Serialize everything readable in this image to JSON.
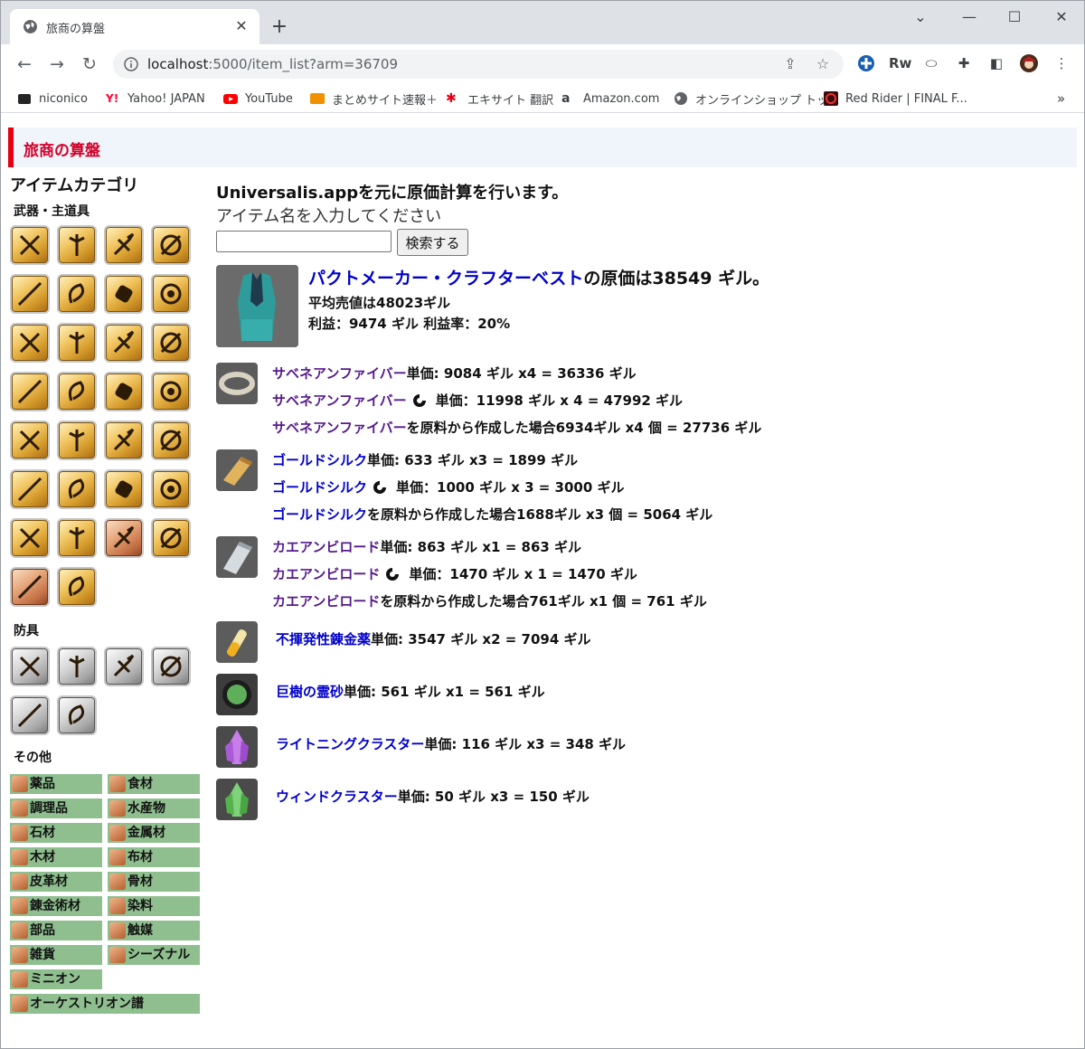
{
  "browser": {
    "tab_title": "旅商の算盤",
    "url_host": "localhost",
    "url_rest": ":5000/item_list?arm=36709",
    "bookmarks": [
      "niconico",
      "Yahoo! JAPAN",
      "YouTube",
      "まとめサイト速報＋",
      "エキサイト 翻訳",
      "Amazon.com",
      "オンラインショップ トッ...",
      "Red Rider | FINAL F..."
    ],
    "more_bookmarks": "»"
  },
  "header": {
    "site_title": "旅商の算盤"
  },
  "sidebar": {
    "title": "アイテムカテゴリ",
    "weapons_label": "武器・主道具",
    "armor_label": "防具",
    "other_label": "その他",
    "misc": [
      "薬品",
      "食材",
      "調理品",
      "水産物",
      "石材",
      "金属材",
      "木材",
      "布材",
      "皮革材",
      "骨材",
      "錬金術材",
      "染料",
      "部品",
      "触媒",
      "雑貨",
      "シーズナル",
      "ミニオン",
      "オーケストリオン譜"
    ]
  },
  "main": {
    "lead": "Universalis.appを元に原価計算を行います。",
    "prompt": "アイテム名を入力してください",
    "search_value": "",
    "search_button": "検索する",
    "product": {
      "name": "パクトメーカー・クラフターベスト",
      "title_suffix": "の原価は38549 ギル。",
      "avg_price": "平均売値は48023ギル",
      "profit": "利益：9474 ギル 利益率：20%"
    },
    "materials": [
      {
        "name": "サベネアンファイバー",
        "nq": " 単価: 9084 ギル x4 = 36336 ギル",
        "hq": "単価：11998 ギル x 4 = 47992 ギル",
        "craft": "を原料から作成した場合6934ギル x4 個 = 27736 ギル"
      },
      {
        "name": "ゴールドシルク",
        "nq": " 単価: 633 ギル x3 = 1899 ギル",
        "hq": "単価：1000 ギル x 3 = 3000 ギル",
        "craft": "を原料から作成した場合1688ギル x3 個 = 5064 ギル"
      },
      {
        "name": "カエアンビロード",
        "nq": " 単価: 863 ギル x1 = 863 ギル",
        "hq": "単価：1470 ギル x 1 = 1470 ギル",
        "craft": "を原料から作成した場合761ギル x1 個 = 761 ギル"
      },
      {
        "name": "不揮発性錬金薬",
        "nq": " 単価: 3547 ギル x2 = 7094 ギル"
      },
      {
        "name": "巨樹の霊砂",
        "nq": " 単価: 561 ギル x1 = 561 ギル"
      },
      {
        "name": "ライトニングクラスター",
        "nq": " 単価: 116 ギル x3 = 348 ギル"
      },
      {
        "name": "ウィンドクラスター",
        "nq": " 単価: 50 ギル x3 = 150 ギル"
      }
    ]
  }
}
